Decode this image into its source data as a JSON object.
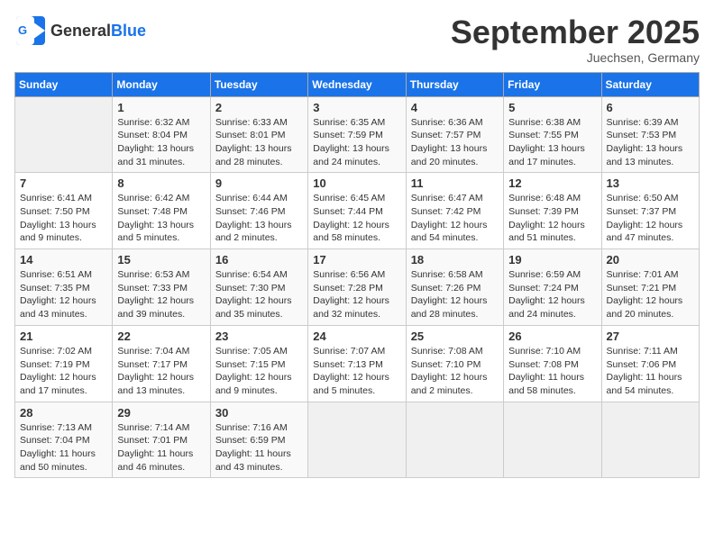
{
  "logo": {
    "text_general": "General",
    "text_blue": "Blue"
  },
  "title": "September 2025",
  "location": "Juechsen, Germany",
  "days_header": [
    "Sunday",
    "Monday",
    "Tuesday",
    "Wednesday",
    "Thursday",
    "Friday",
    "Saturday"
  ],
  "weeks": [
    [
      {
        "day": "",
        "info": ""
      },
      {
        "day": "1",
        "info": "Sunrise: 6:32 AM\nSunset: 8:04 PM\nDaylight: 13 hours\nand 31 minutes."
      },
      {
        "day": "2",
        "info": "Sunrise: 6:33 AM\nSunset: 8:01 PM\nDaylight: 13 hours\nand 28 minutes."
      },
      {
        "day": "3",
        "info": "Sunrise: 6:35 AM\nSunset: 7:59 PM\nDaylight: 13 hours\nand 24 minutes."
      },
      {
        "day": "4",
        "info": "Sunrise: 6:36 AM\nSunset: 7:57 PM\nDaylight: 13 hours\nand 20 minutes."
      },
      {
        "day": "5",
        "info": "Sunrise: 6:38 AM\nSunset: 7:55 PM\nDaylight: 13 hours\nand 17 minutes."
      },
      {
        "day": "6",
        "info": "Sunrise: 6:39 AM\nSunset: 7:53 PM\nDaylight: 13 hours\nand 13 minutes."
      }
    ],
    [
      {
        "day": "7",
        "info": "Sunrise: 6:41 AM\nSunset: 7:50 PM\nDaylight: 13 hours\nand 9 minutes."
      },
      {
        "day": "8",
        "info": "Sunrise: 6:42 AM\nSunset: 7:48 PM\nDaylight: 13 hours\nand 5 minutes."
      },
      {
        "day": "9",
        "info": "Sunrise: 6:44 AM\nSunset: 7:46 PM\nDaylight: 13 hours\nand 2 minutes."
      },
      {
        "day": "10",
        "info": "Sunrise: 6:45 AM\nSunset: 7:44 PM\nDaylight: 12 hours\nand 58 minutes."
      },
      {
        "day": "11",
        "info": "Sunrise: 6:47 AM\nSunset: 7:42 PM\nDaylight: 12 hours\nand 54 minutes."
      },
      {
        "day": "12",
        "info": "Sunrise: 6:48 AM\nSunset: 7:39 PM\nDaylight: 12 hours\nand 51 minutes."
      },
      {
        "day": "13",
        "info": "Sunrise: 6:50 AM\nSunset: 7:37 PM\nDaylight: 12 hours\nand 47 minutes."
      }
    ],
    [
      {
        "day": "14",
        "info": "Sunrise: 6:51 AM\nSunset: 7:35 PM\nDaylight: 12 hours\nand 43 minutes."
      },
      {
        "day": "15",
        "info": "Sunrise: 6:53 AM\nSunset: 7:33 PM\nDaylight: 12 hours\nand 39 minutes."
      },
      {
        "day": "16",
        "info": "Sunrise: 6:54 AM\nSunset: 7:30 PM\nDaylight: 12 hours\nand 35 minutes."
      },
      {
        "day": "17",
        "info": "Sunrise: 6:56 AM\nSunset: 7:28 PM\nDaylight: 12 hours\nand 32 minutes."
      },
      {
        "day": "18",
        "info": "Sunrise: 6:58 AM\nSunset: 7:26 PM\nDaylight: 12 hours\nand 28 minutes."
      },
      {
        "day": "19",
        "info": "Sunrise: 6:59 AM\nSunset: 7:24 PM\nDaylight: 12 hours\nand 24 minutes."
      },
      {
        "day": "20",
        "info": "Sunrise: 7:01 AM\nSunset: 7:21 PM\nDaylight: 12 hours\nand 20 minutes."
      }
    ],
    [
      {
        "day": "21",
        "info": "Sunrise: 7:02 AM\nSunset: 7:19 PM\nDaylight: 12 hours\nand 17 minutes."
      },
      {
        "day": "22",
        "info": "Sunrise: 7:04 AM\nSunset: 7:17 PM\nDaylight: 12 hours\nand 13 minutes."
      },
      {
        "day": "23",
        "info": "Sunrise: 7:05 AM\nSunset: 7:15 PM\nDaylight: 12 hours\nand 9 minutes."
      },
      {
        "day": "24",
        "info": "Sunrise: 7:07 AM\nSunset: 7:13 PM\nDaylight: 12 hours\nand 5 minutes."
      },
      {
        "day": "25",
        "info": "Sunrise: 7:08 AM\nSunset: 7:10 PM\nDaylight: 12 hours\nand 2 minutes."
      },
      {
        "day": "26",
        "info": "Sunrise: 7:10 AM\nSunset: 7:08 PM\nDaylight: 11 hours\nand 58 minutes."
      },
      {
        "day": "27",
        "info": "Sunrise: 7:11 AM\nSunset: 7:06 PM\nDaylight: 11 hours\nand 54 minutes."
      }
    ],
    [
      {
        "day": "28",
        "info": "Sunrise: 7:13 AM\nSunset: 7:04 PM\nDaylight: 11 hours\nand 50 minutes."
      },
      {
        "day": "29",
        "info": "Sunrise: 7:14 AM\nSunset: 7:01 PM\nDaylight: 11 hours\nand 46 minutes."
      },
      {
        "day": "30",
        "info": "Sunrise: 7:16 AM\nSunset: 6:59 PM\nDaylight: 11 hours\nand 43 minutes."
      },
      {
        "day": "",
        "info": ""
      },
      {
        "day": "",
        "info": ""
      },
      {
        "day": "",
        "info": ""
      },
      {
        "day": "",
        "info": ""
      }
    ]
  ]
}
